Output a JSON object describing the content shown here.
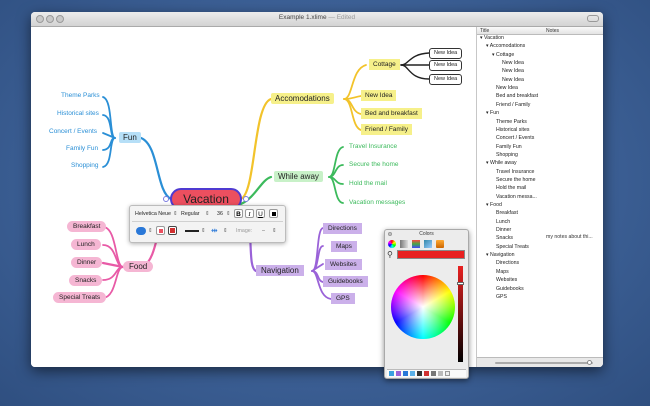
{
  "window": {
    "title": "Example 1.xlime",
    "edited": "Edited"
  },
  "outline": {
    "col_title": "Title",
    "col_notes": "Notes",
    "rows": [
      {
        "text": "▾ Vacation",
        "indent": 0
      },
      {
        "text": "▾ Accomodations",
        "indent": 1
      },
      {
        "text": "▾ Cottage",
        "indent": 2
      },
      {
        "text": "New Idea",
        "indent": 3
      },
      {
        "text": "New Idea",
        "indent": 3
      },
      {
        "text": "New Idea",
        "indent": 3
      },
      {
        "text": "New Idea",
        "indent": 2
      },
      {
        "text": "Bed and breakfast",
        "indent": 2
      },
      {
        "text": "Friend / Family",
        "indent": 2
      },
      {
        "text": "▾ Fun",
        "indent": 1
      },
      {
        "text": "Theme Parks",
        "indent": 2
      },
      {
        "text": "Historical sites",
        "indent": 2
      },
      {
        "text": "Concert / Events",
        "indent": 2
      },
      {
        "text": "Family Fun",
        "indent": 2
      },
      {
        "text": "Shopping",
        "indent": 2
      },
      {
        "text": "▾ While away",
        "indent": 1
      },
      {
        "text": "Travel Insurance",
        "indent": 2
      },
      {
        "text": "Secure the home",
        "indent": 2
      },
      {
        "text": "Hold the mail",
        "indent": 2
      },
      {
        "text": "Vacation messa...",
        "indent": 2
      },
      {
        "text": "▾ Food",
        "indent": 1
      },
      {
        "text": "Breakfast",
        "indent": 2
      },
      {
        "text": "Lunch",
        "indent": 2
      },
      {
        "text": "Dinner",
        "indent": 2
      },
      {
        "text": "Snacks",
        "indent": 2
      },
      {
        "text": "Special Treats",
        "indent": 2
      },
      {
        "text": "▾ Navigation",
        "indent": 1
      },
      {
        "text": "Directions",
        "indent": 2
      },
      {
        "text": "Maps",
        "indent": 2
      },
      {
        "text": "Websites",
        "indent": 2
      },
      {
        "text": "Guidebooks",
        "indent": 2
      },
      {
        "text": "GPS",
        "indent": 2
      }
    ],
    "note_special": "my notes about thi..."
  },
  "map": {
    "central": "Vacation",
    "fun": {
      "label": "Fun",
      "children": [
        "Theme Parks",
        "Historical sites",
        "Concert / Events",
        "Family Fun",
        "Shopping"
      ]
    },
    "accom": {
      "label": "Accomodations",
      "cottage": "Cottage",
      "ideas": [
        "New Idea",
        "New Idea",
        "New Idea"
      ],
      "children": [
        "New Idea",
        "Bed and breakfast",
        "Friend / Family"
      ]
    },
    "while": {
      "label": "While away",
      "children": [
        "Travel Insurance",
        "Secure the home",
        "Hold the mail",
        "Vacation messages"
      ]
    },
    "food": {
      "label": "Food",
      "children": [
        "Breakfast",
        "Lunch",
        "Dinner",
        "Snacks",
        "Special Treats"
      ]
    },
    "nav": {
      "label": "Navigation",
      "children": [
        "Directions",
        "Maps",
        "Websites",
        "Guidebooks",
        "GPS"
      ]
    }
  },
  "toolbar": {
    "font_family": "Helvetica Neue",
    "font_style": "Regular",
    "font_size": "36",
    "bold": "B",
    "italic": "I",
    "underline": "U",
    "image_label": "Image:",
    "image_value": "–"
  },
  "colors_panel": {
    "title": "Colors"
  },
  "colors": {
    "fun": "#2a8fd6",
    "accom": "#f2c32b",
    "while": "#3cba5c",
    "food": "#e85aa6",
    "nav": "#9a62d8",
    "central_fill": "#ec4f5f",
    "selected_color": "#e82020"
  }
}
